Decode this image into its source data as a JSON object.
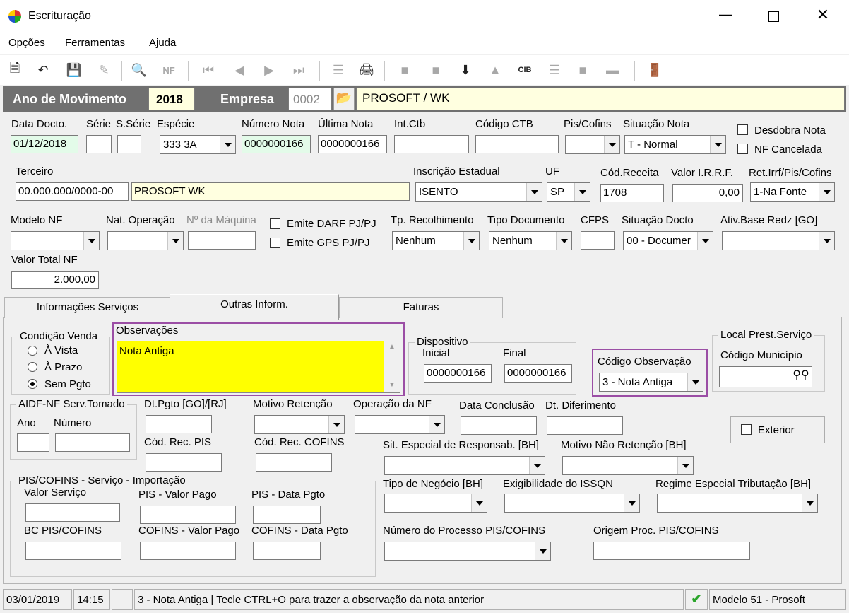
{
  "window": {
    "title": "Escrituração"
  },
  "menu": {
    "opcoes": "Opções",
    "ferramentas": "Ferramentas",
    "ajuda": "Ajuda"
  },
  "header": {
    "ano_label": "Ano de Movimento",
    "ano_value": "2018",
    "empresa_label": "Empresa",
    "empresa_code": "0002",
    "empresa_name": "PROSOFT / WK"
  },
  "row1": {
    "data_docto_label": "Data Docto.",
    "data_docto": "01/12/2018",
    "serie_label": "Série",
    "sserie_label": "S.Série",
    "especie_label": "Espécie",
    "especie": "333 3A",
    "numero_nota_label": "Número Nota",
    "numero_nota": "0000000166",
    "ultima_nota_label": "Última Nota",
    "ultima_nota": "0000000166",
    "intctb_label": "Int.Ctb",
    "codigo_ctb_label": "Código CTB",
    "piscofins_label": "Pis/Cofins",
    "situacao_nota_label": "Situação Nota",
    "situacao_nota": "T - Normal",
    "desdobra_label": "Desdobra Nota",
    "nf_cancelada_label": "NF Cancelada"
  },
  "row2": {
    "terceiro_label": "Terceiro",
    "terceiro_doc": "00.000.000/0000-00",
    "terceiro_name": "PROSOFT WK",
    "ie_label": "Inscrição Estadual",
    "ie": "ISENTO",
    "uf_label": "UF",
    "uf": "SP",
    "codreceita_label": "Cód.Receita",
    "codreceita": "1708",
    "irrf_label": "Valor I.R.R.F.",
    "irrf": "0,00",
    "retirrf_label": "Ret.Irrf/Pis/Cofins",
    "retirrf": "1-Na Fonte"
  },
  "row3": {
    "modelo_label": "Modelo NF",
    "natop_label": "Nat. Operação",
    "maquina_label": "Nº da Máquina",
    "darf_label": "Emite DARF PJ/PJ",
    "gps_label": "Emite GPS PJ/PJ",
    "tprec_label": "Tp. Recolhimento",
    "tprec": "Nenhum",
    "tipodoc_label": "Tipo Documento",
    "tipodoc": "Nenhum",
    "cfps_label": "CFPS",
    "sitdocto_label": "Situação Docto",
    "sitdocto": "00 - Documer",
    "ativbase_label": "Ativ.Base Redz [GO]",
    "valor_total_label": "Valor Total NF",
    "valor_total": "2.000,00"
  },
  "tabs": [
    {
      "label": "Informações Serviços"
    },
    {
      "label": "Outras Inform."
    },
    {
      "label": "Faturas"
    }
  ],
  "panel": {
    "cond_venda_label": "Condição Venda",
    "avista": "À Vista",
    "aprazo": "À Prazo",
    "sempgto": "Sem Pgto",
    "obs_label": "Observações",
    "obs_text": "Nota Antiga",
    "dispositivo_label": "Dispositivo",
    "inicial_label": "Inicial",
    "inicial": "0000000166",
    "final_label": "Final",
    "final": "0000000166",
    "cod_obs_label": "Código Observação",
    "cod_obs": "3 - Nota Antiga",
    "local_prest_label": "Local Prest.Serviço",
    "cod_municipio_label": "Código Município",
    "aidf_label": "AIDF-NF Serv.Tomado",
    "ano_label": "Ano",
    "numero_label": "Número",
    "dtpgto_label": "Dt.Pgto [GO]/[RJ]",
    "motivo_ret_label": "Motivo Retenção",
    "operacao_label": "Operação da NF",
    "data_conclusao_label": "Data Conclusão",
    "dt_diferimento_label": "Dt. Diferimento",
    "exterior_label": "Exterior",
    "cod_rec_pis_label": "Cód. Rec. PIS",
    "cod_rec_cofins_label": "Cód. Rec. COFINS",
    "sit_especial_label": "Sit. Especial de Responsab. [BH]",
    "motivo_nao_ret_label": "Motivo Não Retenção [BH]",
    "piscofins_group_label": "PIS/COFINS - Serviço - Importação",
    "valor_servico_label": "Valor Serviço",
    "pis_valor_label": "PIS - Valor Pago",
    "pis_data_label": "PIS - Data Pgto",
    "bc_label": "BC PIS/COFINS",
    "cofins_valor_label": "COFINS - Valor Pago",
    "cofins_data_label": "COFINS - Data Pgto",
    "tipo_negocio_label": "Tipo de Negócio [BH]",
    "exigibilidade_label": "Exigibilidade do ISSQN",
    "regime_label": "Regime Especial Tributação [BH]",
    "num_processo_label": "Número do Processo PIS/COFINS",
    "origem_proc_label": "Origem Proc. PIS/COFINS"
  },
  "status": {
    "date": "03/01/2019",
    "time": "14:15",
    "message": "3 - Nota Antiga | Tecle CTRL+O para trazer a observação da nota anterior",
    "model": "Modelo 51 - Prosoft"
  },
  "colors": {
    "header_bg": "#707070",
    "highlight_border": "#9b4ea5",
    "obs_bg": "#ffff00"
  }
}
